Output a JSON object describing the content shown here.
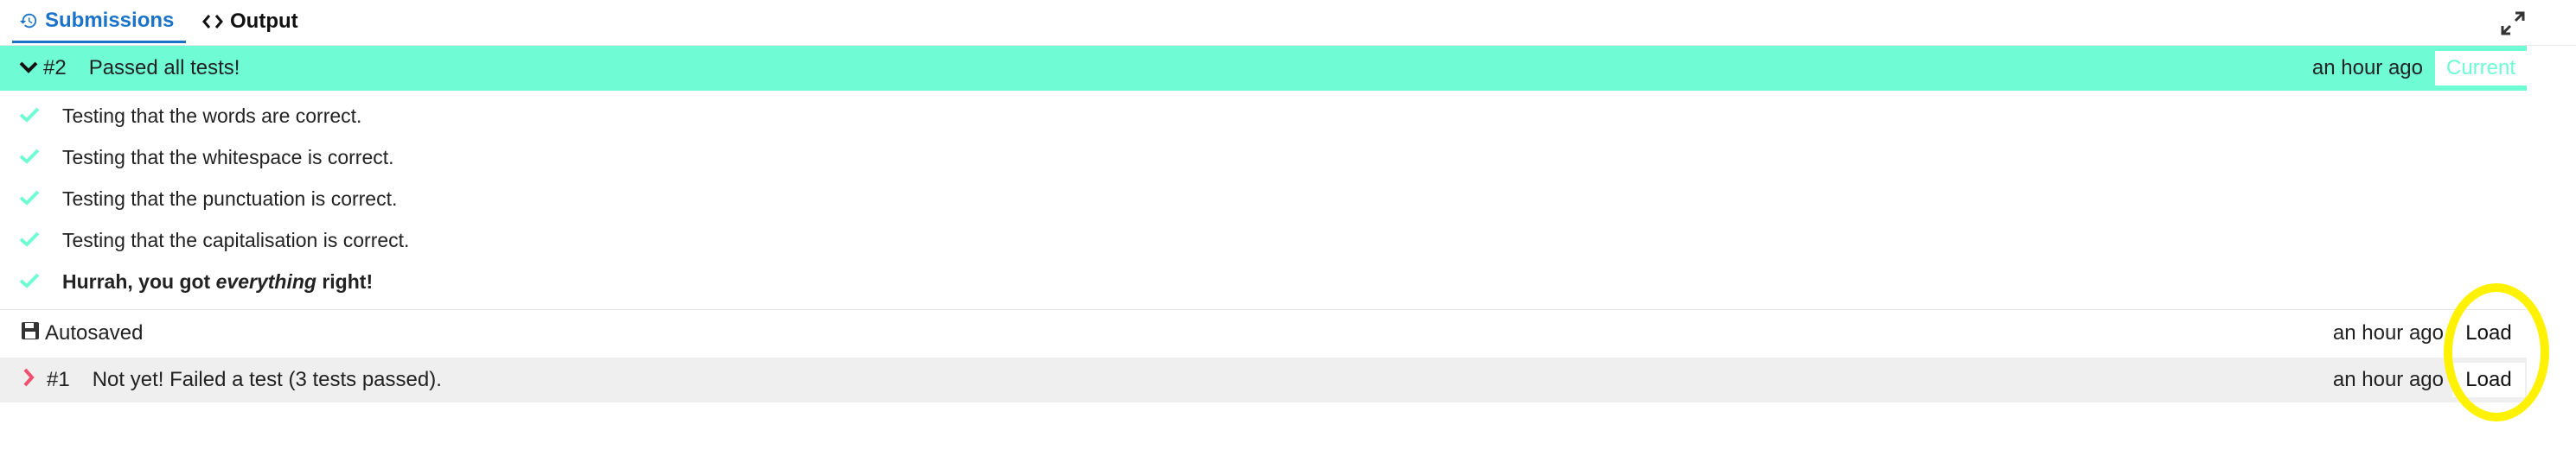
{
  "tabs": {
    "submissions_label": "Submissions",
    "output_label": "Output"
  },
  "current_submission": {
    "number": "#2",
    "status": "Passed all tests!",
    "time": "an hour ago",
    "current_label": "Current"
  },
  "tests": [
    {
      "text": "Testing that the words are correct."
    },
    {
      "text": "Testing that the whitespace is correct."
    },
    {
      "text": "Testing that the punctuation is correct."
    },
    {
      "text": "Testing that the capitalisation is correct."
    }
  ],
  "final_message": {
    "before": "Hurrah, you got ",
    "emphasis": "everything",
    "after": " right!"
  },
  "autosaved": {
    "label": "Autosaved",
    "time": "an hour ago",
    "load_label": "Load"
  },
  "failed_submission": {
    "number": "#1",
    "status": "Not yet! Failed a test (3 tests passed).",
    "time": "an hour ago",
    "load_label": "Load"
  },
  "colors": {
    "accent_blue": "#1a73c8",
    "pass_green": "#6ffcd4",
    "fail_red": "#f0506e",
    "highlight": "#fff200"
  },
  "icons": {
    "history": "history-icon",
    "code": "code-icon",
    "expand": "expand-icon",
    "chevron_down": "chevron-down-icon",
    "chevron_right": "chevron-right-icon",
    "check": "check-icon",
    "save": "save-icon"
  }
}
